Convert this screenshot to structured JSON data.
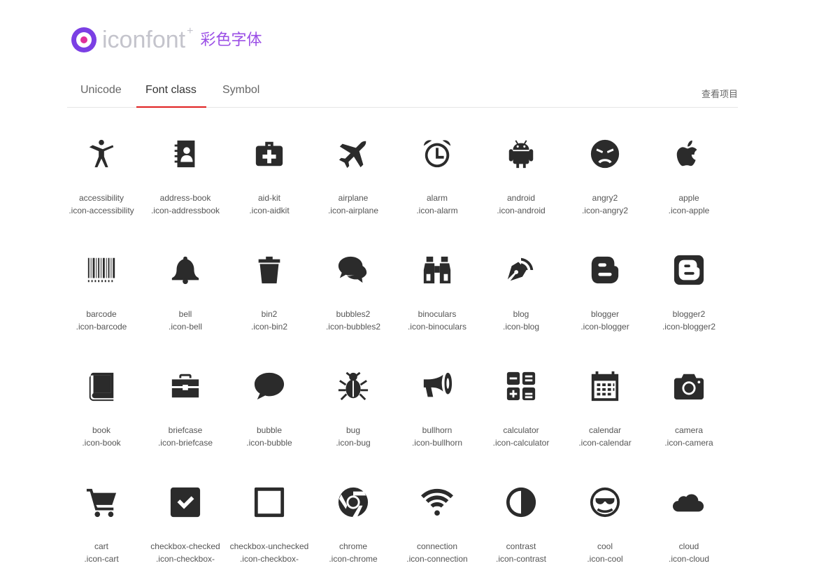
{
  "brand": {
    "name": "iconfont",
    "plus": "+",
    "subtitle": "彩色字体"
  },
  "tabs": [
    {
      "label": "Unicode",
      "active": false
    },
    {
      "label": "Font class",
      "active": true
    },
    {
      "label": "Symbol",
      "active": false
    }
  ],
  "project_link": "查看项目",
  "colors": {
    "accent": "#e02020",
    "icon": "#2b2b2b",
    "logo_purple": "#7b3fe4",
    "logo_pink": "#e0309a"
  },
  "icons": [
    {
      "name": "accessibility",
      "class": ".icon-accessibility",
      "icon": "accessibility-icon"
    },
    {
      "name": "address-book",
      "class": ".icon-addressbook",
      "icon": "address-book-icon"
    },
    {
      "name": "aid-kit",
      "class": ".icon-aidkit",
      "icon": "aid-kit-icon"
    },
    {
      "name": "airplane",
      "class": ".icon-airplane",
      "icon": "airplane-icon"
    },
    {
      "name": "alarm",
      "class": ".icon-alarm",
      "icon": "alarm-icon"
    },
    {
      "name": "android",
      "class": ".icon-android",
      "icon": "android-icon"
    },
    {
      "name": "angry2",
      "class": ".icon-angry2",
      "icon": "angry-icon"
    },
    {
      "name": "apple",
      "class": ".icon-apple",
      "icon": "apple-icon"
    },
    {
      "name": "barcode",
      "class": ".icon-barcode",
      "icon": "barcode-icon"
    },
    {
      "name": "bell",
      "class": ".icon-bell",
      "icon": "bell-icon"
    },
    {
      "name": "bin2",
      "class": ".icon-bin2",
      "icon": "bin-icon"
    },
    {
      "name": "bubbles2",
      "class": ".icon-bubbles2",
      "icon": "bubbles-icon"
    },
    {
      "name": "binoculars",
      "class": ".icon-binoculars",
      "icon": "binoculars-icon"
    },
    {
      "name": "blog",
      "class": ".icon-blog",
      "icon": "blog-icon"
    },
    {
      "name": "blogger",
      "class": ".icon-blogger",
      "icon": "blogger-icon"
    },
    {
      "name": "blogger2",
      "class": ".icon-blogger2",
      "icon": "blogger2-icon"
    },
    {
      "name": "book",
      "class": ".icon-book",
      "icon": "book-icon"
    },
    {
      "name": "briefcase",
      "class": ".icon-briefcase",
      "icon": "briefcase-icon"
    },
    {
      "name": "bubble",
      "class": ".icon-bubble",
      "icon": "bubble-icon"
    },
    {
      "name": "bug",
      "class": ".icon-bug",
      "icon": "bug-icon"
    },
    {
      "name": "bullhorn",
      "class": ".icon-bullhorn",
      "icon": "bullhorn-icon"
    },
    {
      "name": "calculator",
      "class": ".icon-calculator",
      "icon": "calculator-icon"
    },
    {
      "name": "calendar",
      "class": ".icon-calendar",
      "icon": "calendar-icon"
    },
    {
      "name": "camera",
      "class": ".icon-camera",
      "icon": "camera-icon"
    },
    {
      "name": "cart",
      "class": ".icon-cart",
      "icon": "cart-icon"
    },
    {
      "name": "checkbox-checked",
      "class": ".icon-checkbox-checked",
      "icon": "checkbox-checked-icon"
    },
    {
      "name": "checkbox-unchecked",
      "class": ".icon-checkbox-unchecked",
      "icon": "checkbox-unchecked-icon"
    },
    {
      "name": "chrome",
      "class": ".icon-chrome",
      "icon": "chrome-icon"
    },
    {
      "name": "connection",
      "class": ".icon-connection",
      "icon": "connection-icon"
    },
    {
      "name": "contrast",
      "class": ".icon-contrast",
      "icon": "contrast-icon"
    },
    {
      "name": "cool",
      "class": ".icon-cool",
      "icon": "cool-icon"
    },
    {
      "name": "cloud",
      "class": ".icon-cloud",
      "icon": "cloud-icon"
    }
  ]
}
